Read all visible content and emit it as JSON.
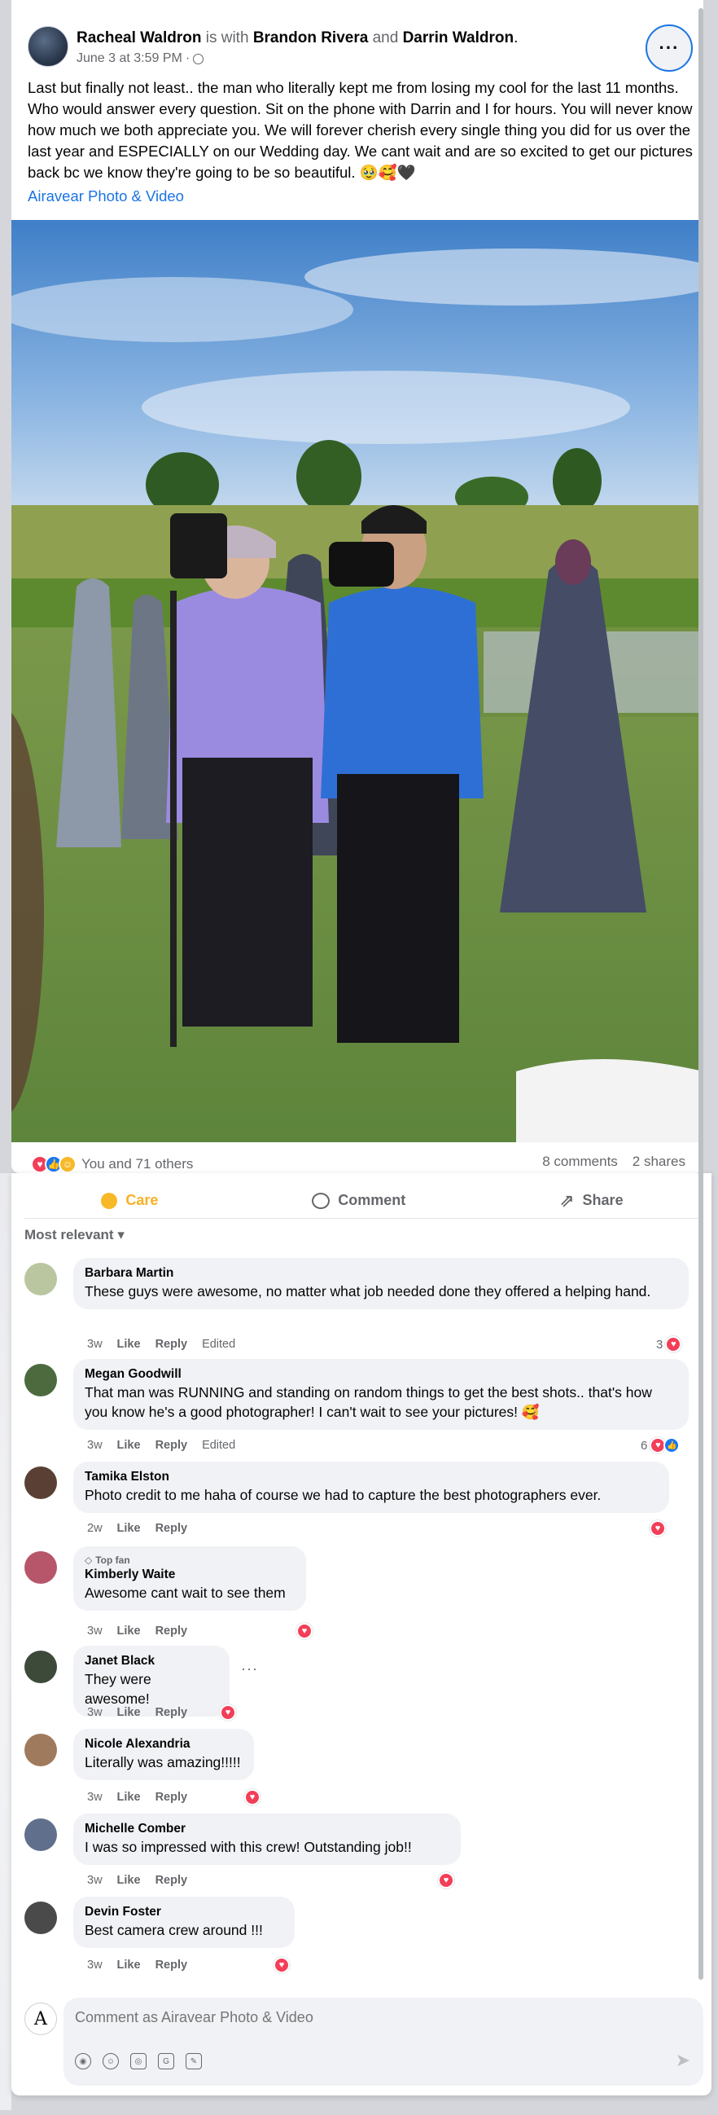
{
  "post": {
    "author": "Racheal Waldron",
    "with_text": "is with",
    "tagged_1": "Brandon Rivera",
    "and_text": "and",
    "tagged_2": "Darrin Waldron",
    "period": ".",
    "timestamp": "June 3 at 3:59 PM",
    "separator": "·",
    "more_label": "···",
    "text": "Last but finally not least.. the man who literally kept me from losing my cool for the last 11 months. Who would answer every question. Sit on the phone with Darrin and I for hours. You will never know how much we both appreciate you. We will forever cherish every single thing you did for us over the last year and ESPECIALLY on our Wedding day. We cant wait and are so excited to get our pictures back bc we know they're going to be so beautiful. 🥹🥰🖤",
    "page_link": "Airavear Photo & Video"
  },
  "reactions": {
    "summary": "You and 71 others",
    "comments_count": "8 comments",
    "shares_count": "2 shares"
  },
  "actions": {
    "care": "Care",
    "comment": "Comment",
    "share": "Share"
  },
  "sort_label": "Most relevant",
  "comments": [
    {
      "name": "Barbara Martin",
      "text": "These guys were awesome, no matter what job needed done they offered a helping hand.",
      "time": "3w",
      "like": "Like",
      "reply": "Reply",
      "edited": "Edited",
      "reaction_count": "3",
      "avatar_color": "#b9c6a0"
    },
    {
      "name": "Megan Goodwill",
      "text": "That man was RUNNING and standing on random things to get the best shots.. that's how you know he's a good photographer! I can't wait to see your pictures! 🥰",
      "time": "3w",
      "like": "Like",
      "reply": "Reply",
      "edited": "Edited",
      "reaction_count": "6",
      "avatar_color": "#4c6a3e"
    },
    {
      "name": "Tamika Elston",
      "text": "Photo credit to me haha of course we had to capture the best photographers ever.",
      "time": "2w",
      "like": "Like",
      "reply": "Reply",
      "avatar_color": "#5a4034"
    },
    {
      "badge": "Top fan",
      "name": "Kimberly Waite",
      "text": "Awesome cant wait to see them",
      "time": "3w",
      "like": "Like",
      "reply": "Reply",
      "avatar_color": "#b7566a"
    },
    {
      "name": "Janet Black",
      "text": "They were awesome!",
      "time": "3w",
      "like": "Like",
      "reply": "Reply",
      "more": "···",
      "avatar_color": "#3d4a3a"
    },
    {
      "name": "Nicole Alexandria",
      "text": "Literally was amazing!!!!!",
      "time": "3w",
      "like": "Like",
      "reply": "Reply",
      "avatar_color": "#a07a5c"
    },
    {
      "name": "Michelle Comber",
      "text": "I was so impressed with this crew! Outstanding job!!",
      "time": "3w",
      "like": "Like",
      "reply": "Reply",
      "avatar_color": "#5f6f8c"
    },
    {
      "name": "Devin Foster",
      "text": "Best camera crew around !!!",
      "time": "3w",
      "like": "Like",
      "reply": "Reply",
      "avatar_color": "#4a4a4a"
    }
  ],
  "composer": {
    "avatar_letter": "A",
    "placeholder": "Comment as Airavear Photo & Video",
    "send_icon": "send-icon"
  },
  "colors": {
    "link": "#1b74e4",
    "care": "#f7b125",
    "love": "#f33e58",
    "like": "#1877f2",
    "muted": "#65676b"
  }
}
